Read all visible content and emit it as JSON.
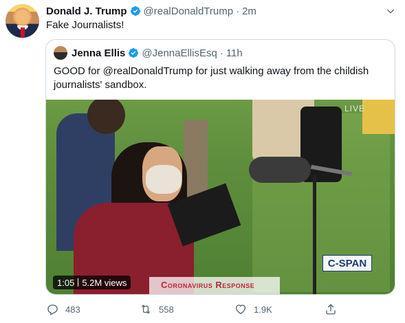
{
  "tweet": {
    "author_name": "Donald J. Trump",
    "author_handle": "@realDonaldTrump",
    "separator": "·",
    "time": "2m",
    "text": "Fake Journalists!"
  },
  "quoted_tweet": {
    "author_name": "Jenna Ellis",
    "author_handle": "@JennaEllisEsq",
    "separator": "·",
    "time": "11h",
    "text": "GOOD for @realDonaldTrump for just walking away from the childish journalists' sandbox."
  },
  "video": {
    "duration": "1:05",
    "views": "5.2M views",
    "live_label": "LIVE",
    "network_logo": "C-SPAN",
    "banner": "Coronavirus Response"
  },
  "actions": {
    "reply_count": "483",
    "retweet_count": "558",
    "like_count": "1.9K"
  },
  "icons": {
    "verified": "verified-badge-icon",
    "more": "chevron-down-icon",
    "reply": "reply-icon",
    "retweet": "retweet-icon",
    "like": "heart-icon",
    "share": "share-icon"
  },
  "colors": {
    "verified_blue": "#1d9bf0",
    "secondary_text": "#536471",
    "border": "#cfd9de",
    "banner_red": "#c5203a"
  }
}
